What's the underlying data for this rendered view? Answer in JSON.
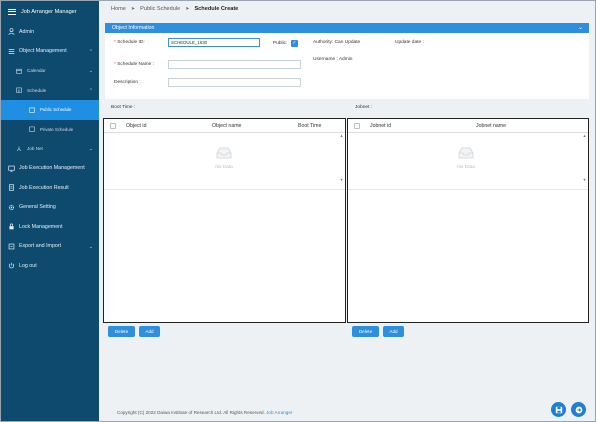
{
  "app": {
    "title": "Job Arranger Manager"
  },
  "sidebar": {
    "user": "Admin",
    "items": [
      {
        "label": "Object Management",
        "icon": "list-icon",
        "expanded": true
      },
      {
        "label": "Calendar",
        "icon": "calendar-icon"
      },
      {
        "label": "Schedule",
        "icon": "schedule-icon",
        "expanded": true
      },
      {
        "label": "Public Schedule"
      },
      {
        "label": "Private Schedule"
      },
      {
        "label": "Job Net",
        "icon": "jobnet-icon"
      },
      {
        "label": "Job Execution Management",
        "icon": "monitor-icon"
      },
      {
        "label": "Job Execution Result",
        "icon": "document-icon"
      },
      {
        "label": "General Setting",
        "icon": "gear-icon"
      },
      {
        "label": "Lock Management",
        "icon": "lock-icon"
      },
      {
        "label": "Export and Import",
        "icon": "export-icon"
      },
      {
        "label": "Log out",
        "icon": "power-icon"
      }
    ]
  },
  "breadcrumb": {
    "home": "Home",
    "parent": "Public Schedule",
    "current": "Schedule Create"
  },
  "object_info": {
    "header": "Object Information",
    "schedule_id_label": "Schedule ID:",
    "schedule_id_value": "SCHEDULE_1630",
    "public_label": "Public:",
    "public_checked": true,
    "authority": "Authority: Can Update",
    "update_date": "Update date :",
    "username": "Username : Admin",
    "schedule_name_label": "Schedule Name :",
    "schedule_name_value": "",
    "description_label": "Description :",
    "description_value": ""
  },
  "boot_time": {
    "label": "Boot Time :",
    "columns": [
      "Object id",
      "Object name",
      "Boot Time"
    ],
    "empty": "No Data",
    "delete_label": "Delete",
    "add_label": "Add"
  },
  "jobnet": {
    "label": "Jobnet :",
    "columns": [
      "Jobnet id",
      "Jobnet name"
    ],
    "empty": "No Data",
    "delete_label": "Delete",
    "add_label": "Add"
  },
  "footer": {
    "text": "Copyright (C) 2022 Daiwa Institute of Research Ltd. All Rights Reserved.",
    "link": "Job Arranger"
  },
  "colors": {
    "sidebar": "#0d4a6e",
    "accent": "#2e8fdc",
    "active": "#1f8fe3",
    "background": "#eef1f4"
  }
}
